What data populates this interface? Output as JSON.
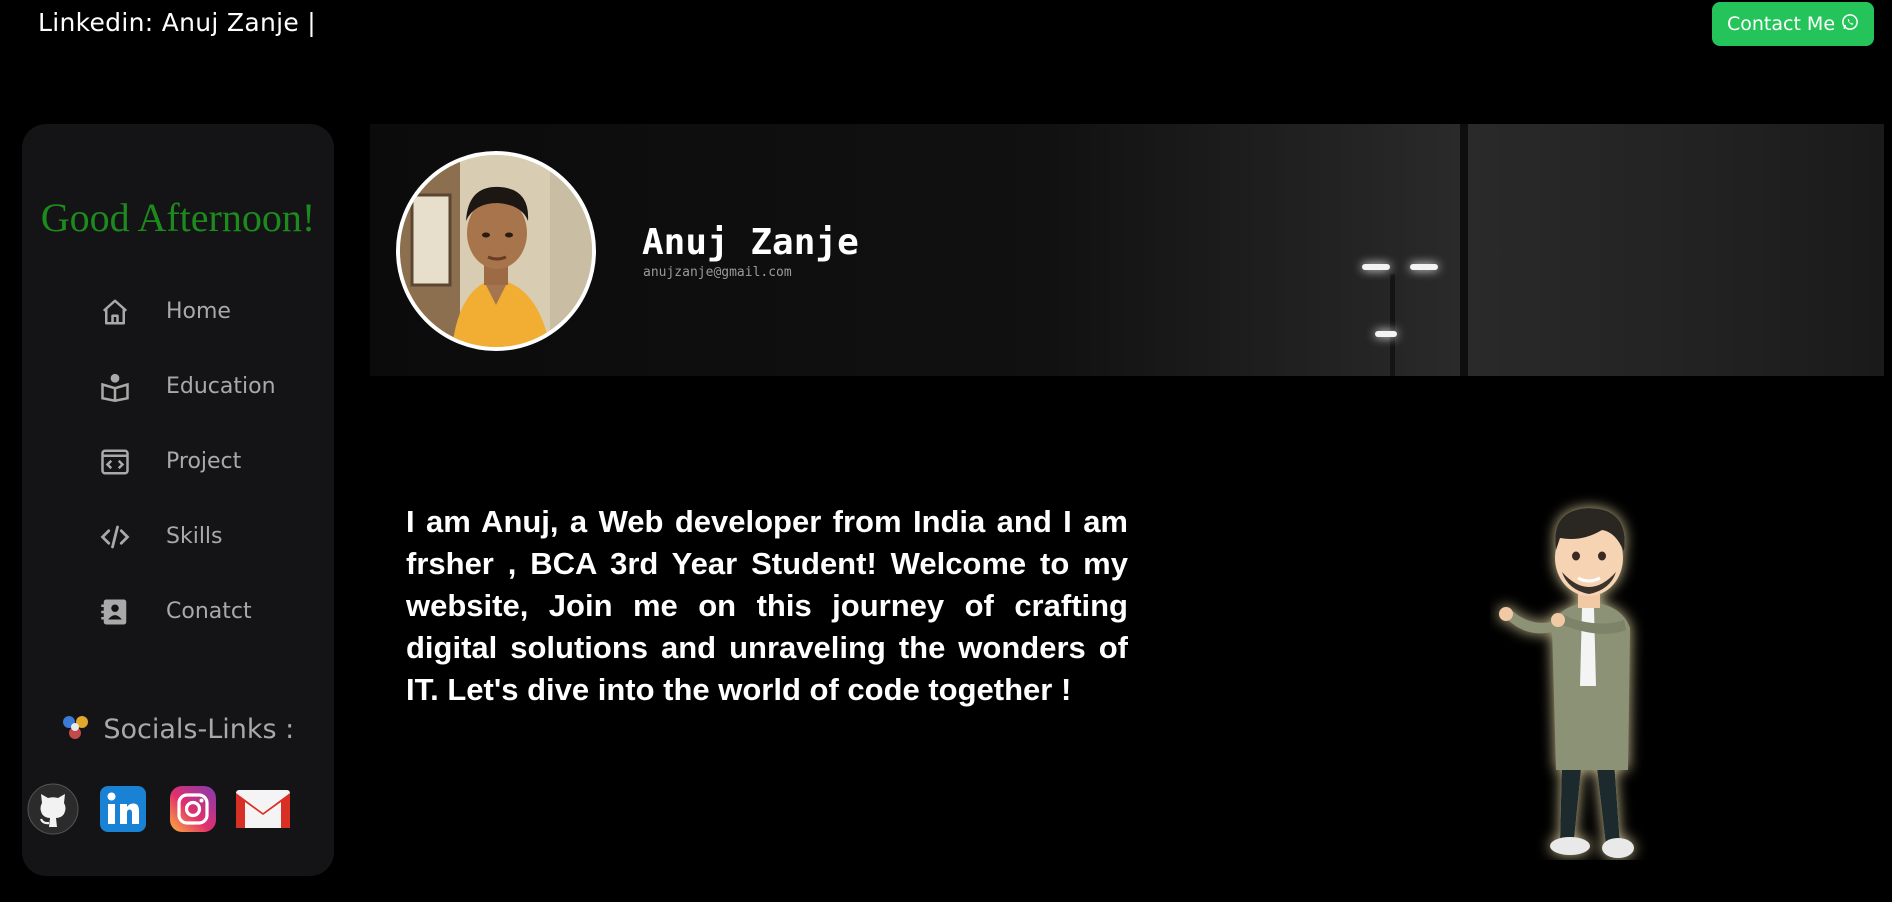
{
  "topbar": {
    "linkedin_text": "Linkedin: Anuj Zanje |",
    "contact_label": "Contact Me",
    "contact_icon": "whatsapp-icon"
  },
  "sidebar": {
    "greeting": "Good Afternoon!",
    "items": [
      {
        "label": "Home",
        "icon": "home-icon"
      },
      {
        "label": "Education",
        "icon": "book-reader-icon"
      },
      {
        "label": "Project",
        "icon": "code-window-icon"
      },
      {
        "label": "Skills",
        "icon": "code-brackets-icon"
      },
      {
        "label": "Conatct",
        "icon": "contact-card-icon"
      }
    ],
    "socials_title": "Socials-Links :",
    "socials": [
      {
        "name": "GitHub",
        "icon": "github-icon"
      },
      {
        "name": "LinkedIn",
        "icon": "linkedin-icon"
      },
      {
        "name": "Instagram",
        "icon": "instagram-icon"
      },
      {
        "name": "Gmail",
        "icon": "gmail-icon"
      }
    ]
  },
  "profile": {
    "name": "Anuj Zanje",
    "email": "anujzanje@gmail.com"
  },
  "intro": {
    "text": "I am Anuj, a Web developer from India and I am frsher , BCA 3rd Year Student! Welcome to my website, Join me on this journey of crafting digital solutions and unraveling the wonders of IT. Let's dive into the world of code together !"
  },
  "colors": {
    "background": "#000000",
    "sidebar": "#141416",
    "greeting": "#1d8a1d",
    "contact_button": "#25c45a",
    "nav_text": "#a9a9a9"
  }
}
